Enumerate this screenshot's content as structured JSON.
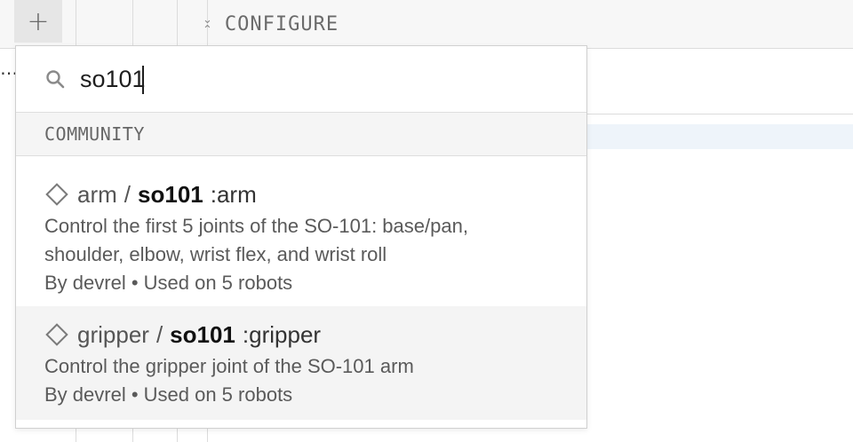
{
  "toolbar": {
    "add_label": "+",
    "configure_label": "CONFIGURE"
  },
  "search": {
    "value": "so101",
    "placeholder": ""
  },
  "section": {
    "title": "COMMUNITY"
  },
  "results": [
    {
      "namespace": "arm",
      "separator": "/",
      "name": "so101",
      "suffix": ":arm",
      "description": "Control the first 5 joints of the SO-101: base/pan, shoulder, elbow, wrist flex, and wrist roll",
      "meta": "By devrel • Used on 5 robots",
      "icon": "diamond-icon"
    },
    {
      "namespace": "gripper",
      "separator": "/",
      "name": "so101",
      "suffix": ":gripper",
      "description": "Control the gripper joint of the SO-101 arm",
      "meta": "By devrel • Used on 5 robots",
      "icon": "diamond-icon"
    }
  ],
  "background": {
    "ellipsis": "⋯"
  },
  "colors": {
    "hover": "#f4f4f4",
    "section_bg": "#f5f5f5",
    "highlight_row": "#eef4fa"
  }
}
